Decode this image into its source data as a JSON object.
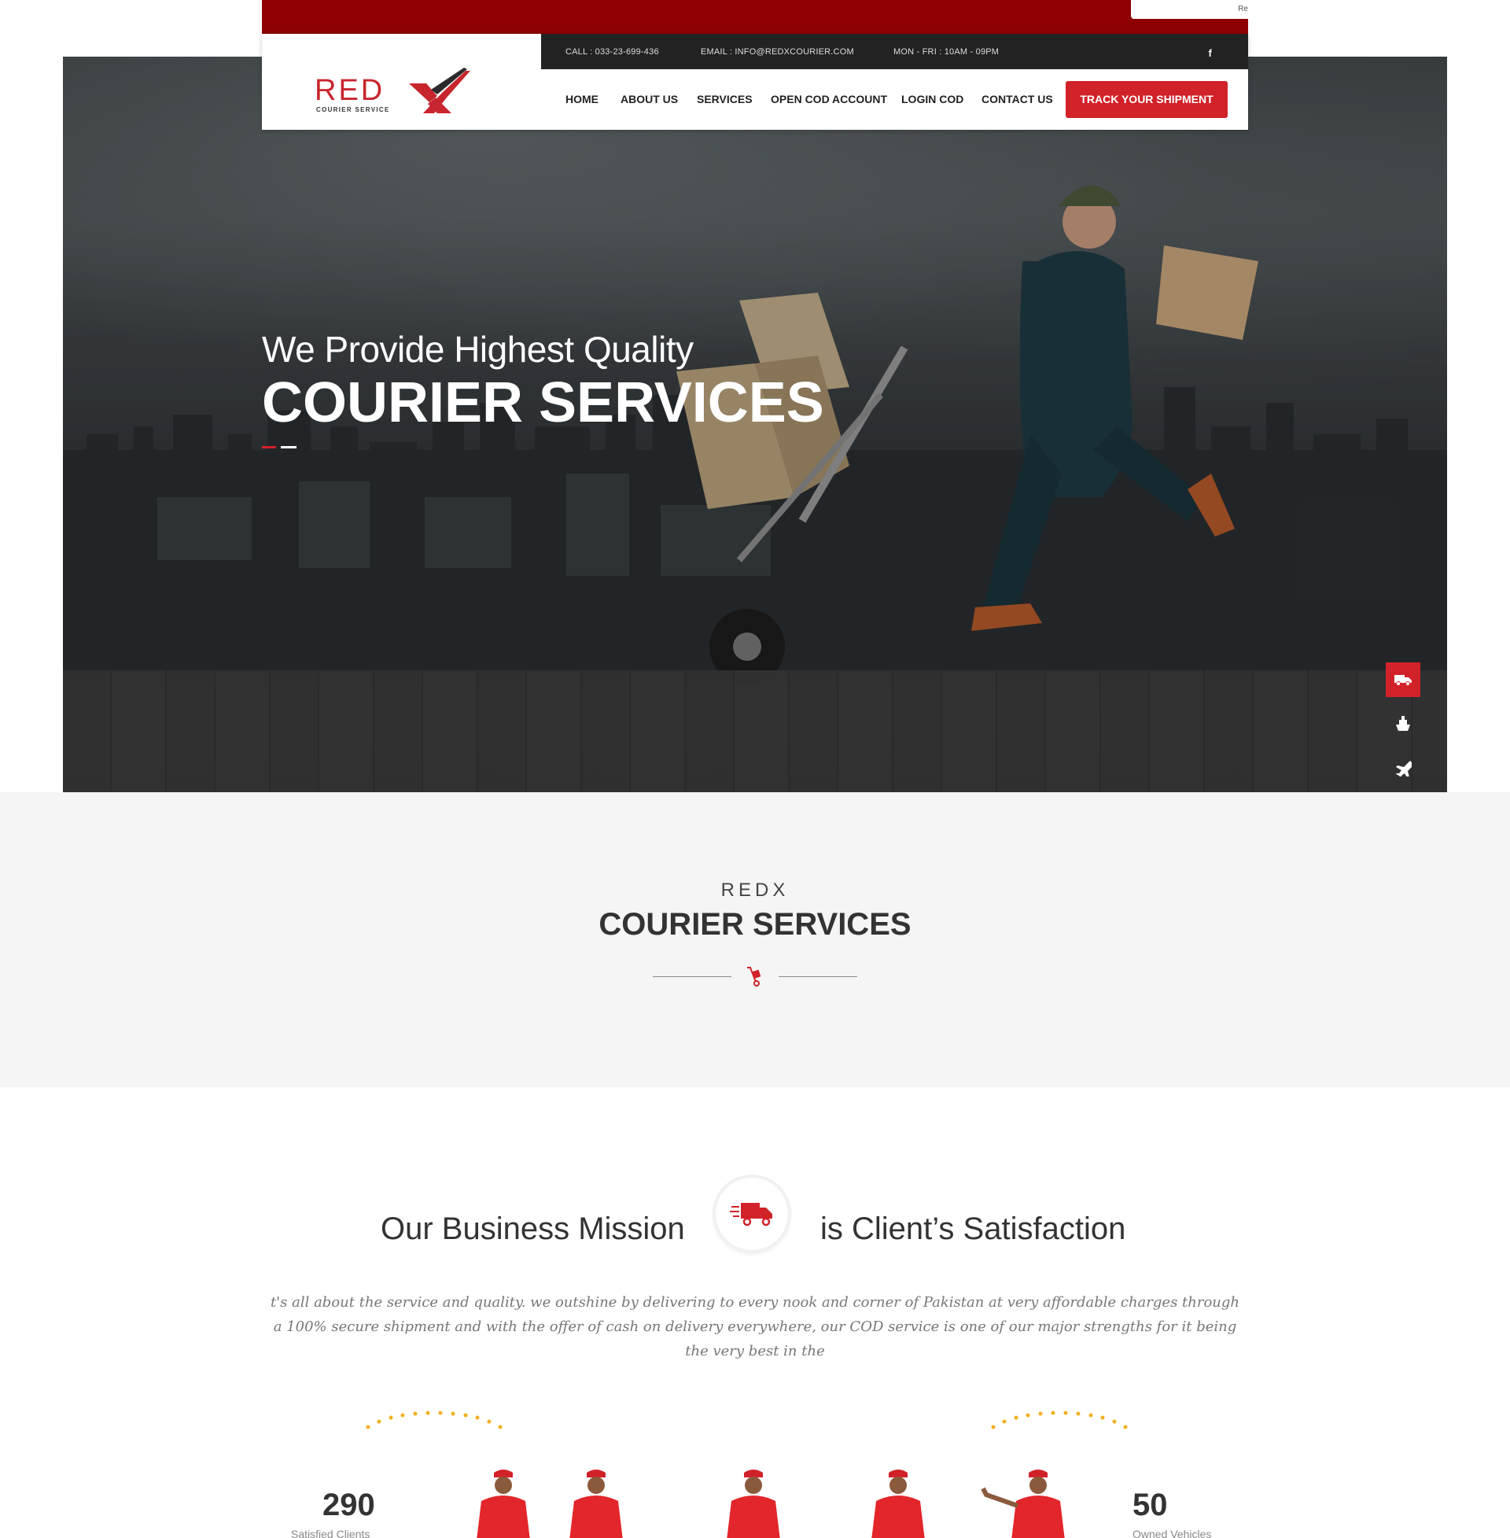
{
  "topbar": {
    "corner_text": "Re"
  },
  "info_bar": {
    "call": "CALL : 033-23-699-436",
    "email": "EMAIL : INFO@REDXCOURIER.COM",
    "hours": "MON - FRI : 10AM - 09PM",
    "social_icon": "facebook-icon",
    "social_glyph": "f"
  },
  "logo": {
    "text": "RED",
    "subtitle": "COURIER SERVICE"
  },
  "nav": {
    "items": [
      "HOME",
      "ABOUT US",
      "SERVICES",
      "OPEN COD ACCOUNT",
      "LOGIN COD",
      "CONTACT US"
    ],
    "cta": "TRACK YOUR SHIPMENT"
  },
  "hero": {
    "line1": "We Provide Highest Quality",
    "line2": "COURIER SERVICES",
    "side_icons": [
      "truck-icon",
      "ship-icon",
      "plane-icon"
    ]
  },
  "services_section": {
    "kicker": "REDX",
    "title": "COURIER SERVICES",
    "divider_icon": "hand-truck-icon"
  },
  "mission": {
    "title_left": "Our Business Mission",
    "title_right": "is Client’s Satisfaction",
    "icon": "delivery-truck-icon",
    "text": "t's all about the service and quality. we outshine by delivering to every nook and corner of Pakistan at very affordable charges through a 100% secure shipment and with the offer of cash on delivery everywhere, our COD service is one of our major strengths for it being the very best in the"
  },
  "stats": [
    {
      "value": "290",
      "label": "Satisfied Clients"
    },
    {
      "value": "50",
      "label": "Owned Vehicles"
    }
  ],
  "colors": {
    "brand_red": "#d12229",
    "dark_red": "#8e0000",
    "dark_bar": "#222222",
    "accent_yellow": "#f2b01e"
  }
}
